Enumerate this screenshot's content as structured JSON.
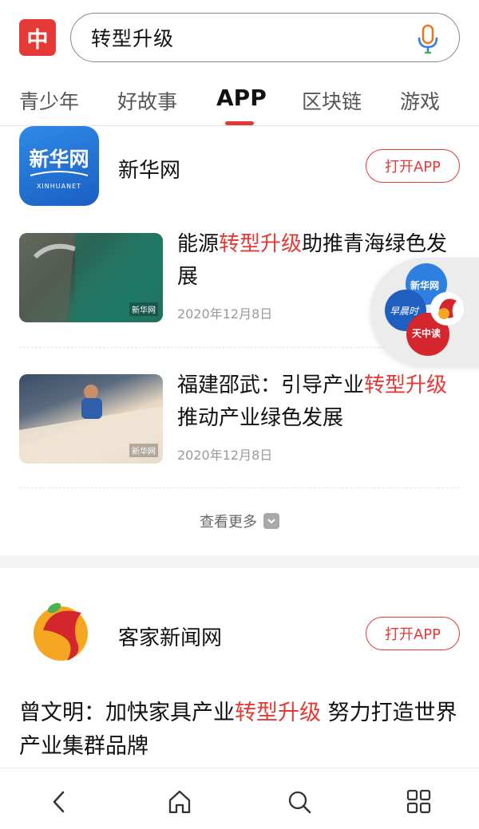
{
  "header": {
    "logo_char": "中",
    "search_value": "转型升级",
    "accent": "#e53935"
  },
  "tabs": [
    {
      "label": "青少年"
    },
    {
      "label": "好故事"
    },
    {
      "label": "APP",
      "active": true
    },
    {
      "label": "区块链"
    },
    {
      "label": "游戏"
    }
  ],
  "apps": [
    {
      "name": "新华网",
      "icon_text": "新华网",
      "icon_subtext": "XINHUANET",
      "open_label": "打开APP"
    },
    {
      "name": "客家新闻网",
      "open_label": "打开APP"
    }
  ],
  "news": [
    {
      "title_pre": "能源",
      "title_hl": "转型升级",
      "title_post": "助推青海绿色发展",
      "date": "2020年12月8日",
      "thumb_badge": "新华网"
    },
    {
      "title_pre": "福建邵武：引导产业",
      "title_hl": "转型升级",
      "title_post": "推动产业绿色发展",
      "date": "2020年12月8日",
      "thumb_badge": "新华网"
    }
  ],
  "more_label": "查看更多",
  "article": {
    "title_pre": "曾文明：加快家具产业",
    "title_hl": "转型升级",
    "title_post": " 努力打造世界产业集群品牌"
  },
  "floating": {
    "label_top": "新华网",
    "label_left": "早晨时",
    "label_bottom": "天中读"
  },
  "bottom_nav": {
    "icons": [
      "back-icon",
      "home-icon",
      "search-icon",
      "apps-grid-icon"
    ]
  }
}
